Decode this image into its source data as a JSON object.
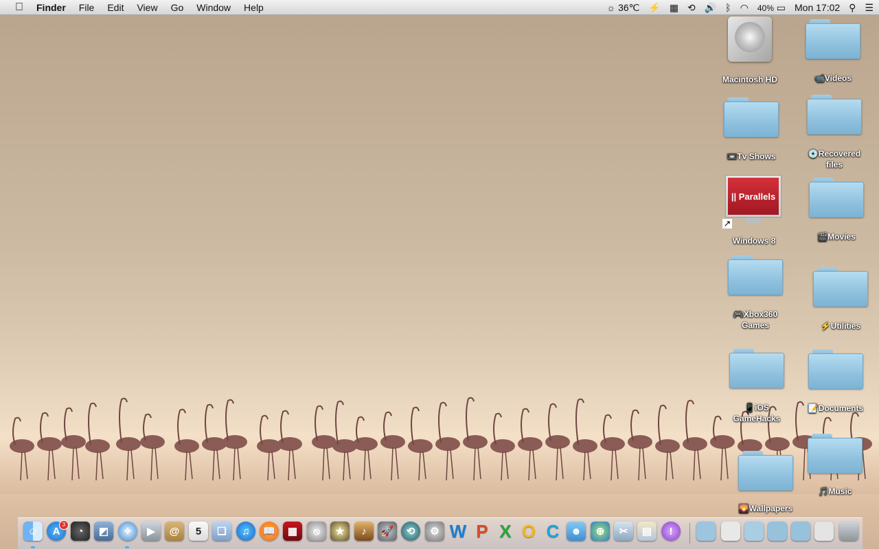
{
  "menubar": {
    "apple_icon": "apple-logo-icon",
    "app_name": "Finder",
    "menus": [
      "File",
      "Edit",
      "View",
      "Go",
      "Window",
      "Help"
    ],
    "status": {
      "weather": "36℃",
      "battery_percent": "40%",
      "clock": "Mon 17:02"
    }
  },
  "desktop": {
    "icons": [
      {
        "label": "Macintosh HD",
        "kind": "hard-drive"
      },
      {
        "label": "📹Videos",
        "kind": "folder"
      },
      {
        "label": "📼Tv Shows",
        "kind": "folder"
      },
      {
        "label": "💿Recovered files",
        "kind": "folder"
      },
      {
        "label": "Windows 8",
        "kind": "parallels-alias",
        "screen_text": "|| Parallels"
      },
      {
        "label": "🎬Movies",
        "kind": "folder"
      },
      {
        "label": "🎮Xbox360 Games",
        "kind": "folder"
      },
      {
        "label": "⚡Utilities",
        "kind": "folder"
      },
      {
        "label": "📱iOS GameHacks",
        "kind": "folder"
      },
      {
        "label": "📝Documents",
        "kind": "folder"
      },
      {
        "label": "🌄Wallpapers",
        "kind": "folder"
      },
      {
        "label": "🎵Music",
        "kind": "folder"
      }
    ]
  },
  "dock": {
    "app_store_badge": "3",
    "calendar_date": "5",
    "apps": [
      "finder",
      "app-store",
      "dashboard",
      "preview",
      "safari",
      "facetime",
      "contacts",
      "calendar",
      "photo-booth",
      "itunes",
      "ibooks",
      "photo-stack",
      "no-entry",
      "imovie-star",
      "garageband",
      "launchpad",
      "time-machine",
      "system-preferences",
      "word",
      "powerpoint",
      "excel",
      "outlook",
      "communicator",
      "messenger",
      "network",
      "utility",
      "preview2",
      "help"
    ],
    "app_letters": {
      "word": "W",
      "powerpoint": "P",
      "excel": "X",
      "outlook": "O",
      "communicator": "C"
    },
    "colors": {
      "word": "#1a7fd4",
      "powerpoint": "#d84a2a",
      "excel": "#2aa53a",
      "outlook": "#f3b521",
      "communicator": "#1fa3dc"
    }
  }
}
